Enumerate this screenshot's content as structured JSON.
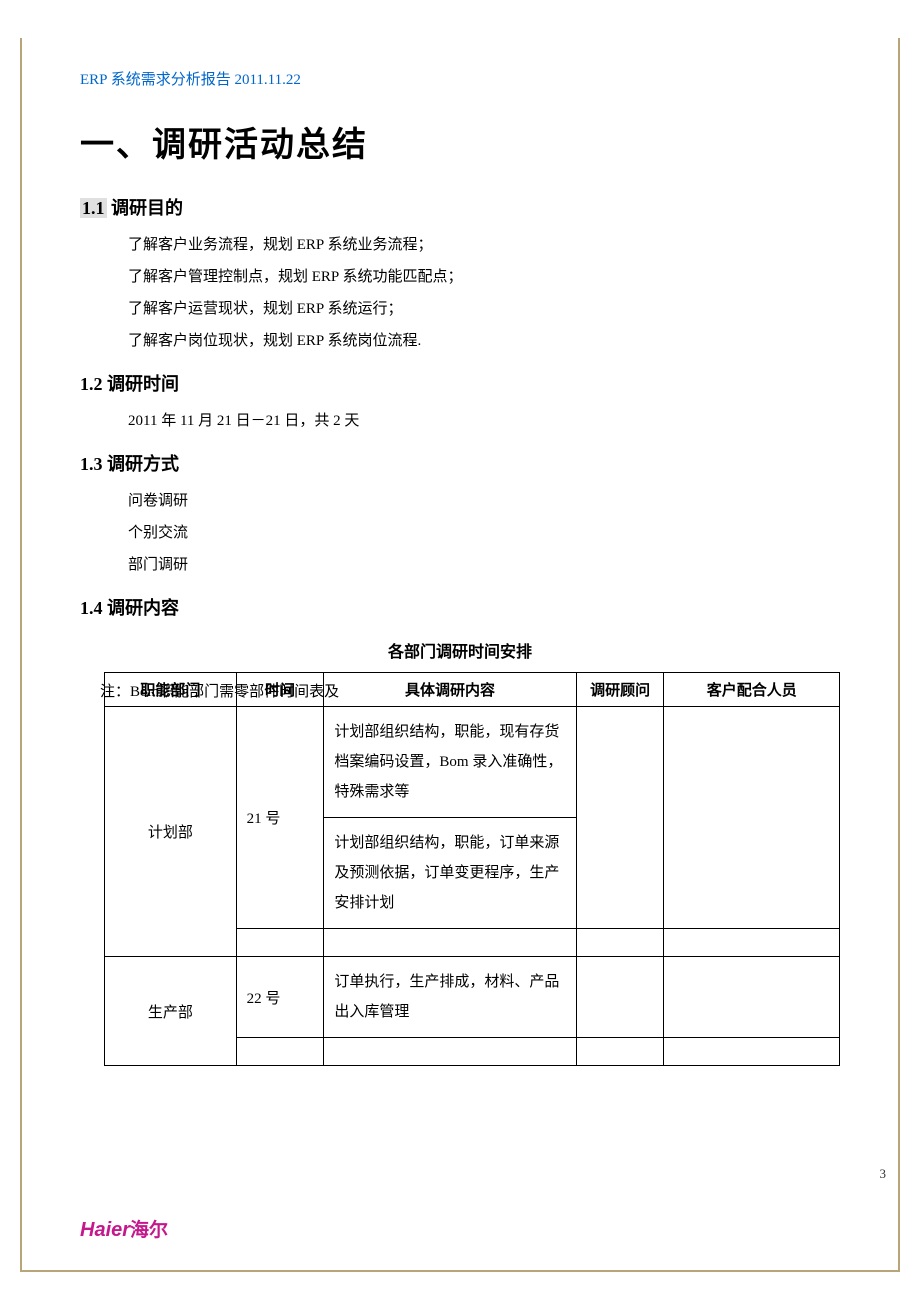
{
  "header": {
    "title": "ERP 系统需求分析报告  2011.11.22"
  },
  "mainHeading": "一、调研活动总结",
  "sections": {
    "s11": {
      "num": "1.1",
      "title": "调研目的",
      "lines": [
        "了解客户业务流程，规划 ERP 系统业务流程；",
        "了解客户管理控制点，规划 ERP 系统功能匹配点；",
        "了解客户运营现状，规划 ERP 系统运行；",
        "了解客户岗位现状，规划 ERP 系统岗位流程."
      ]
    },
    "s12": {
      "num": "1.2",
      "title": "调研时间",
      "lines": [
        "2011 年 11 月 21 日－21 日，共 2 天"
      ]
    },
    "s13": {
      "num": "1.3",
      "title": "调研方式",
      "lines": [
        "问卷调研",
        "个别交流",
        "部门调研"
      ]
    },
    "s14": {
      "num": "1.4",
      "title": "调研内容"
    }
  },
  "table": {
    "title": "各部门调研时间安排",
    "note": "注：Bom职能部门需零部件时间表及",
    "headers": {
      "dept": "职能部门",
      "time": "时间",
      "content": "具体调研内容",
      "consultant": "调研顾问",
      "customer": "客户配合人员"
    },
    "rows": [
      {
        "dept": "计划部",
        "time": "21 号",
        "content1": "计划部组织结构，职能，现有存货档案编码设置，Bom 录入准确性，特殊需求等",
        "content2": "计划部组织结构，职能，订单来源及预测依据，订单变更程序，生产安排计划",
        "consultant": "",
        "customer": ""
      },
      {
        "dept": "生产部",
        "time": "22  号",
        "content1": "订单执行，生产排成，材料、产品出入库管理",
        "consultant": "",
        "customer": ""
      }
    ]
  },
  "footer": {
    "logo_en": "Haier",
    "logo_cn": "海尔",
    "pageNum": "3"
  }
}
